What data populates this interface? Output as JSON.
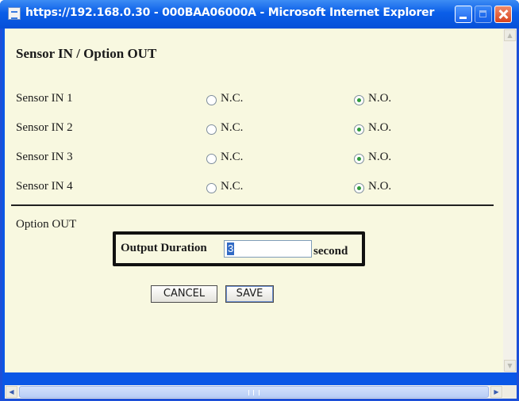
{
  "window": {
    "title": "https://192.168.0.30 - 000BAA06000A - Microsoft Internet Explorer",
    "controls": [
      "minimize",
      "maximize",
      "close"
    ]
  },
  "page": {
    "title": "Sensor IN / Option OUT"
  },
  "sensors": [
    {
      "label": "Sensor IN 1",
      "nc_label": "N.C.",
      "no_label": "N.O.",
      "selected": "N.O."
    },
    {
      "label": "Sensor IN 2",
      "nc_label": "N.C.",
      "no_label": "N.O.",
      "selected": "N.O."
    },
    {
      "label": "Sensor IN 3",
      "nc_label": "N.C.",
      "no_label": "N.O.",
      "selected": "N.O."
    },
    {
      "label": "Sensor IN 4",
      "nc_label": "N.C.",
      "no_label": "N.O.",
      "selected": "N.O."
    }
  ],
  "option_out": {
    "label": "Option OUT",
    "duration_label": "Output Duration",
    "duration_value": "3",
    "duration_unit": "second"
  },
  "buttons": {
    "cancel": "CANCEL",
    "save": "SAVE"
  },
  "colors": {
    "title_bar": "#0a5ee8",
    "page_background": "#f8f8e0",
    "radio_selected": "#2f9a3a",
    "text_selection": "#316ac5"
  },
  "icons": {
    "window_icon": "ie-page-icon",
    "radio_checked": "radio-checked-icon",
    "radio_unchecked": "radio-unchecked-icon"
  }
}
